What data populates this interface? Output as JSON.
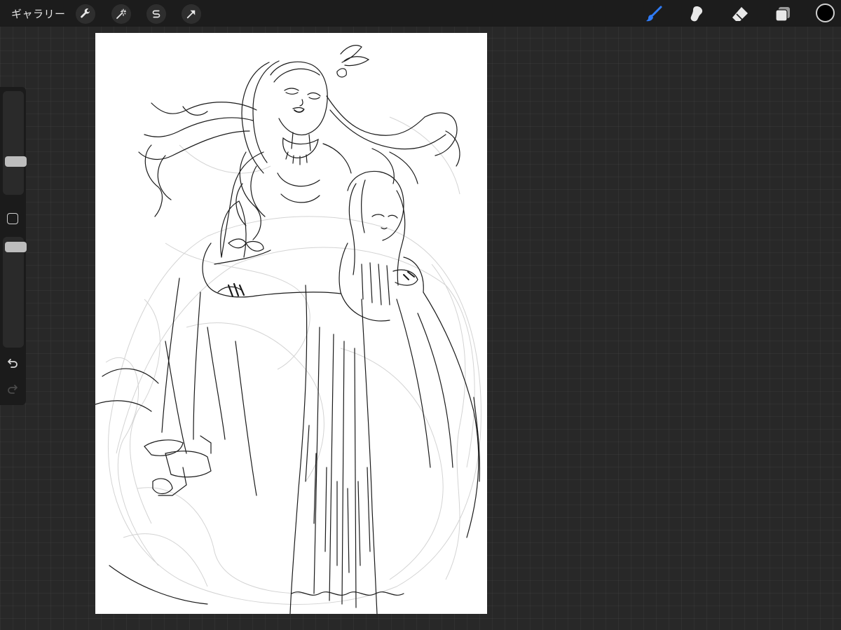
{
  "app": {
    "gallery_label": "ギャラリー"
  },
  "toolbar": {
    "left_tools": [
      {
        "name": "actions",
        "icon": "wrench-icon"
      },
      {
        "name": "adjustments",
        "icon": "magic-wand-icon"
      },
      {
        "name": "selection",
        "icon": "selection-s-icon"
      },
      {
        "name": "transform",
        "icon": "arrow-cursor-icon"
      }
    ],
    "right_tools": [
      {
        "name": "brush",
        "icon": "brush-icon",
        "active": true
      },
      {
        "name": "smudge",
        "icon": "smudge-icon",
        "active": false
      },
      {
        "name": "eraser",
        "icon": "eraser-icon",
        "active": false
      },
      {
        "name": "layers",
        "icon": "layers-icon",
        "active": false
      }
    ],
    "active_color": "#000000",
    "accent_color": "#2f7bf6"
  },
  "sidebar": {
    "brush_size_level": 0.3,
    "opacity_level": 0.95,
    "undo_icon": "undo-icon",
    "redo_icon": "redo-icon"
  }
}
